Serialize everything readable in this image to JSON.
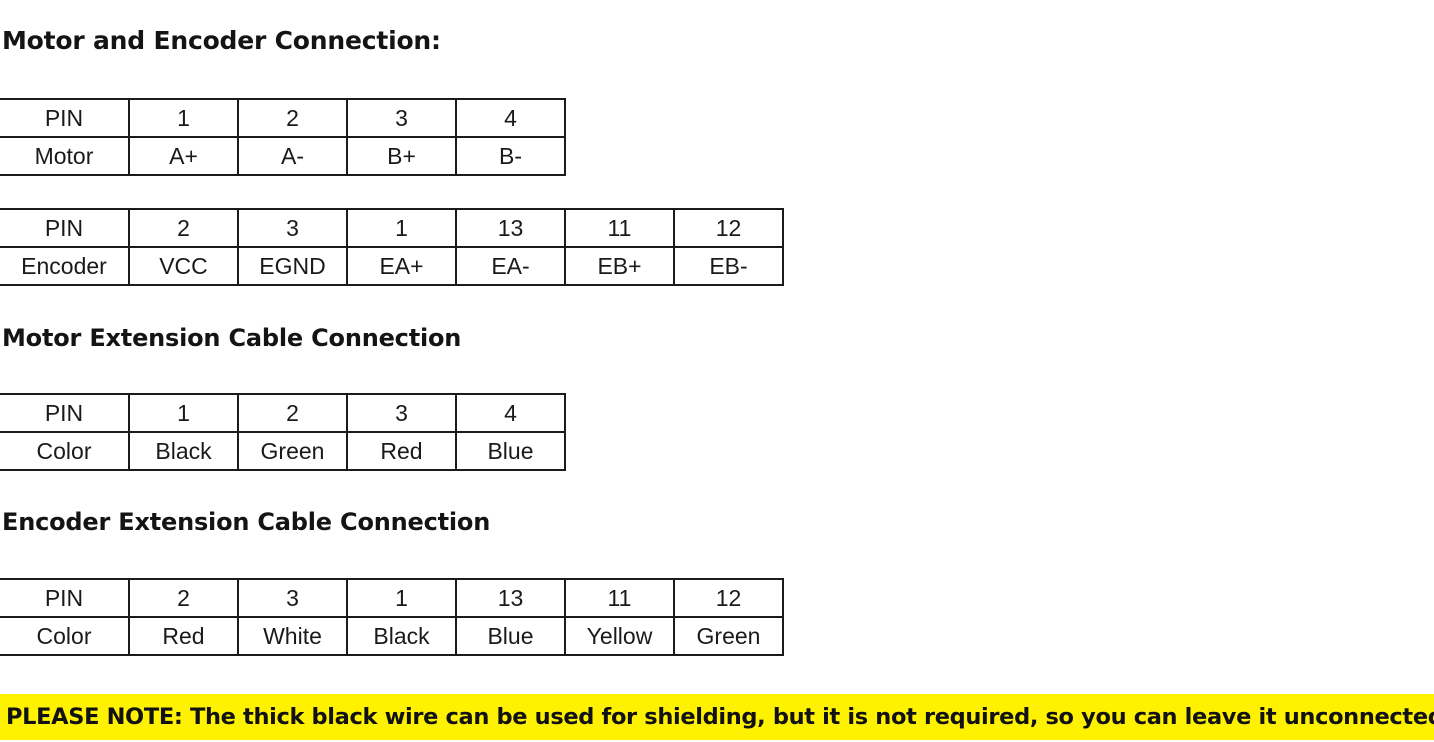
{
  "document": {
    "background_color": "#ffffff",
    "text_color": "#1a1a1a",
    "highlight_color": "#fff200"
  },
  "sections": [
    {
      "heading": "Motor and Encoder Connection:",
      "tables": [
        {
          "name": "motor-connection",
          "rows": [
            [
              "PIN",
              "1",
              "2",
              "3",
              "4"
            ],
            [
              "Motor",
              "A+",
              "A-",
              "B+",
              "B-"
            ]
          ]
        },
        {
          "name": "encoder-connection",
          "rows": [
            [
              "PIN",
              "2",
              "3",
              "1",
              "13",
              "11",
              "12"
            ],
            [
              "Encoder",
              "VCC",
              "EGND",
              "EA+",
              "EA-",
              "EB+",
              "EB-"
            ]
          ]
        }
      ]
    },
    {
      "heading": "Motor Extension Cable Connection",
      "tables": [
        {
          "name": "motor-extension-cable",
          "rows": [
            [
              "PIN",
              "1",
              "2",
              "3",
              "4"
            ],
            [
              "Color",
              "Black",
              "Green",
              "Red",
              "Blue"
            ]
          ]
        }
      ]
    },
    {
      "heading": "Encoder Extension Cable Connection",
      "tables": [
        {
          "name": "encoder-extension-cable",
          "rows": [
            [
              "PIN",
              "2",
              "3",
              "1",
              "13",
              "11",
              "12"
            ],
            [
              "Color",
              "Red",
              "White",
              "Black",
              "Blue",
              "Yellow",
              "Green"
            ]
          ]
        }
      ]
    }
  ],
  "note": {
    "text": "PLEASE NOTE: The thick black wire can be used for shielding, but it is not required, so you can leave it unconnected."
  }
}
